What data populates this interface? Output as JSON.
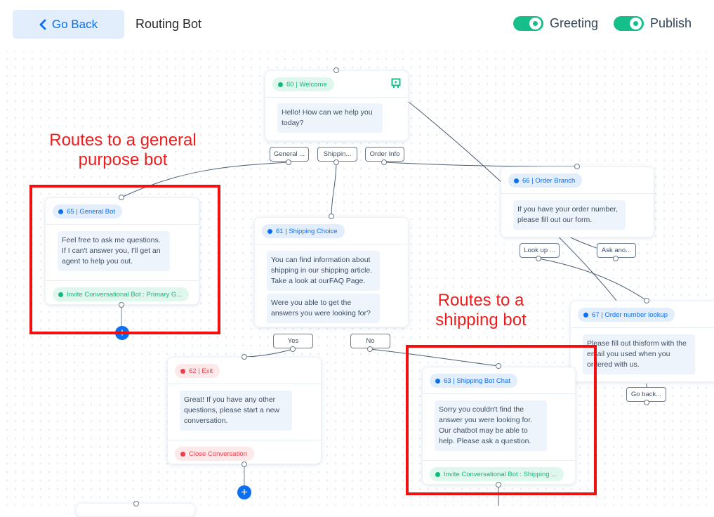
{
  "header": {
    "back_label": "Go Back",
    "title": "Routing Bot",
    "toggles": [
      {
        "label": "Greeting",
        "on": true
      },
      {
        "label": "Publish",
        "on": true
      }
    ]
  },
  "colors": {
    "accent": "#0b6ff2",
    "success": "#16bf8a",
    "danger": "#ee3e4e",
    "annotation": "#f01c1c"
  },
  "nodes": {
    "welcome": {
      "tag": "60 | Welcome",
      "messages": [
        "Hello! How can we help you today?"
      ],
      "choices": [
        "General ...",
        "Shippin...",
        "Order Info"
      ]
    },
    "general_bot": {
      "tag": "65 | General Bot",
      "messages": [
        "Feel free to ask me questions. If I can't answer you, I'll get an agent to help you out."
      ],
      "action": "Invite Conversational Bot : Primary G..."
    },
    "shipping_choice": {
      "tag": "61 | Shipping Choice",
      "messages": [
        "You can find information about shipping in our shipping article. Take a look at ourFAQ Page.",
        "Were you able to get the answers you were looking for?"
      ],
      "choices": [
        "Yes",
        "No"
      ]
    },
    "order_branch": {
      "tag": "66 | Order Branch",
      "messages": [
        "If you have your order number, please fill out our form."
      ],
      "choices": [
        "Look up ...",
        "Ask ano..."
      ]
    },
    "order_lookup": {
      "tag": "67 | Order number lookup",
      "messages": [
        "Please fill out thisform with the email you used when you ordered with us."
      ],
      "choices": [
        "Go back..."
      ]
    },
    "exit": {
      "tag": "62 | Exit",
      "messages": [
        "Great! If you have any other questions, please start a new conversation."
      ],
      "action": "Close Conversation"
    },
    "shipping_bot": {
      "tag": "63 | Shipping Bot Chat",
      "messages": [
        "Sorry you couldn't find the answer you were looking for. Our chatbot may be able to help. Please ask a question."
      ],
      "action": "Invite Conversational Bot : Shipping ..."
    }
  },
  "annotations": {
    "general": "Routes to a general purpose bot",
    "shipping": "Routes to a shipping bot"
  },
  "icons": {
    "add": "+",
    "back": "chevron-left-icon",
    "preview": "preview-icon"
  }
}
